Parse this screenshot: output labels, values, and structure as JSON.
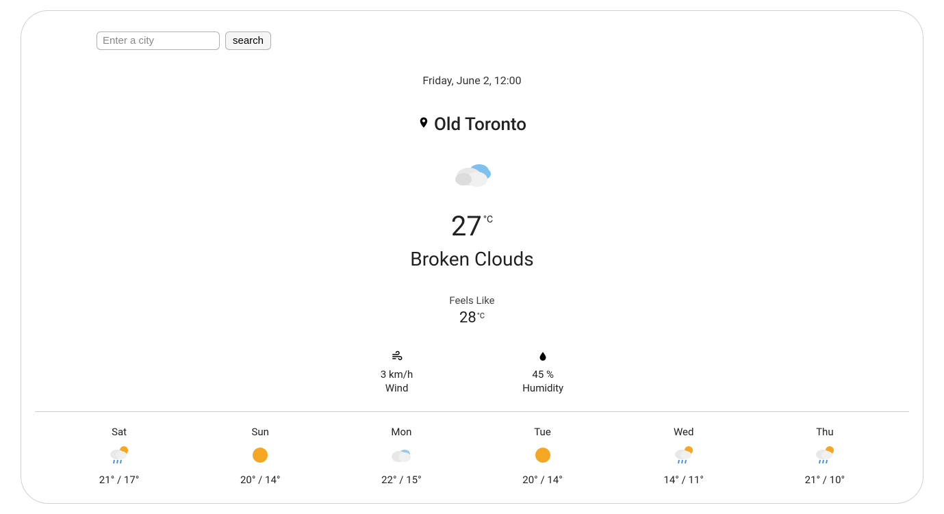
{
  "search": {
    "placeholder": "Enter a city",
    "button_label": "search"
  },
  "current": {
    "datetime": "Friday, June 2, 12:00",
    "location": "Old Toronto",
    "icon": "broken-clouds",
    "temperature": "27",
    "temp_unit": "°C",
    "condition": "Broken Clouds",
    "feels_like_label": "Feels Like",
    "feels_like_value": "28",
    "feels_like_unit": "°C",
    "wind_value": "3 km/h",
    "wind_label": "Wind",
    "humidity_value": "45 %",
    "humidity_label": "Humidity"
  },
  "forecast": [
    {
      "day": "Sat",
      "icon": "rain-sun",
      "temps": "21° / 17°"
    },
    {
      "day": "Sun",
      "icon": "sun",
      "temps": "20° / 14°"
    },
    {
      "day": "Mon",
      "icon": "cloud",
      "temps": "22° / 15°"
    },
    {
      "day": "Tue",
      "icon": "sun",
      "temps": "20° / 14°"
    },
    {
      "day": "Wed",
      "icon": "rain-sun",
      "temps": "14° / 11°"
    },
    {
      "day": "Thu",
      "icon": "rain-sun",
      "temps": "21° / 10°"
    }
  ]
}
